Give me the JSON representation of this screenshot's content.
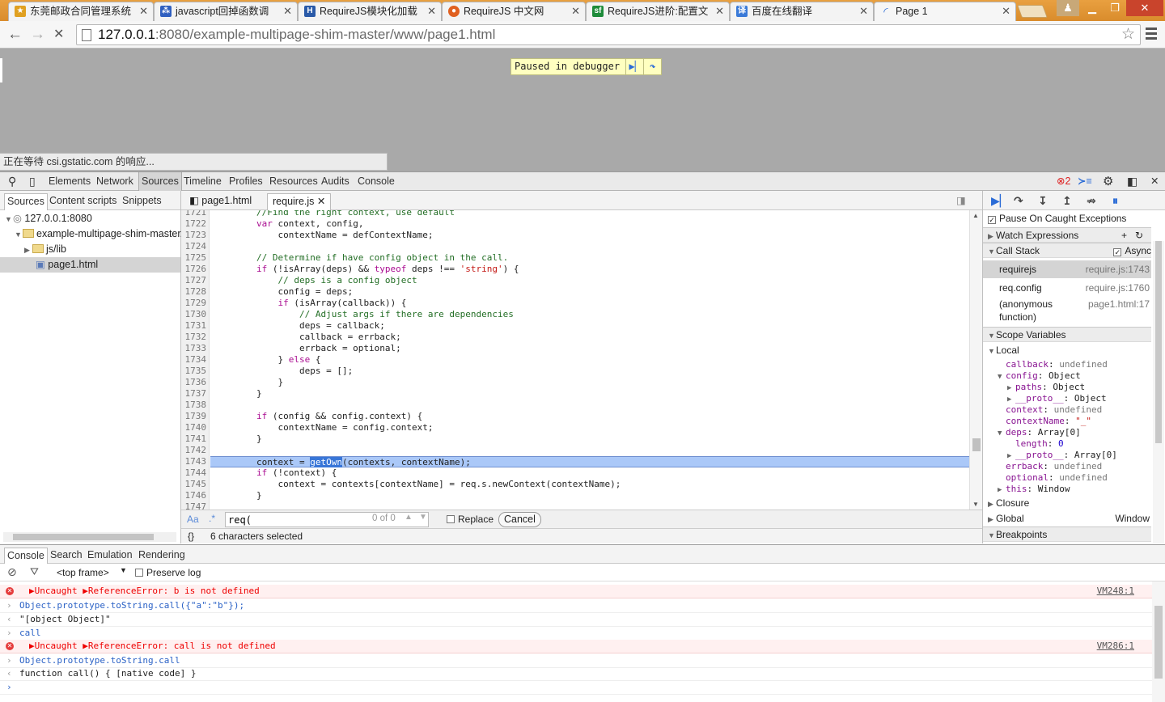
{
  "browser": {
    "tabs": [
      {
        "title": "东莞邮政合同管理系统",
        "favicon_color": "#e0a020"
      },
      {
        "title": "javascript回掉函数调",
        "favicon_color": "#3060c0"
      },
      {
        "title": "RequireJS模块化加载",
        "favicon_color": "#2a5aa8"
      },
      {
        "title": "RequireJS 中文网",
        "favicon_color": "#e06020"
      },
      {
        "title": "RequireJS进阶:配置文",
        "favicon_color": "#1e8c3a"
      },
      {
        "title": "百度在线翻译",
        "favicon_color": "#3a7ad8"
      },
      {
        "title": "Page 1",
        "favicon_color": "#2a6bd6"
      }
    ],
    "url_host": "127.0.0.1",
    "url_path": ":8080/example-multipage-shim-master/www/page1.html"
  },
  "viewport": {
    "paused_text": "Paused in debugger",
    "status_text": "正在等待 csi.gstatic.com 的响应..."
  },
  "devtools": {
    "main_tabs": [
      "Elements",
      "Network",
      "Sources",
      "Timeline",
      "Profiles",
      "Resources",
      "Audits",
      "Console"
    ],
    "error_count": "2",
    "nav_tabs": [
      "Sources",
      "Content scripts",
      "Snippets"
    ],
    "tree": {
      "host": "127.0.0.1:8080",
      "folder": "example-multipage-shim-master/",
      "subfolder": "js/lib",
      "file": "page1.html"
    },
    "editor_tabs": [
      "page1.html",
      "require.js"
    ],
    "code_lines": [
      {
        "n": "1721",
        "t": "        //Find the right context, use default"
      },
      {
        "n": "1722",
        "t": "        var context, config,"
      },
      {
        "n": "1723",
        "t": "            contextName = defContextName;"
      },
      {
        "n": "1724",
        "t": ""
      },
      {
        "n": "1725",
        "t": "        // Determine if have config object in the call."
      },
      {
        "n": "1726",
        "t": "        if (!isArray(deps) && typeof deps !== 'string') {"
      },
      {
        "n": "1727",
        "t": "            // deps is a config object"
      },
      {
        "n": "1728",
        "t": "            config = deps;"
      },
      {
        "n": "1729",
        "t": "            if (isArray(callback)) {"
      },
      {
        "n": "1730",
        "t": "                // Adjust args if there are dependencies"
      },
      {
        "n": "1731",
        "t": "                deps = callback;"
      },
      {
        "n": "1732",
        "t": "                callback = errback;"
      },
      {
        "n": "1733",
        "t": "                errback = optional;"
      },
      {
        "n": "1734",
        "t": "            } else {"
      },
      {
        "n": "1735",
        "t": "                deps = [];"
      },
      {
        "n": "1736",
        "t": "            }"
      },
      {
        "n": "1737",
        "t": "        }"
      },
      {
        "n": "1738",
        "t": ""
      },
      {
        "n": "1739",
        "t": "        if (config && config.context) {"
      },
      {
        "n": "1740",
        "t": "            contextName = config.context;"
      },
      {
        "n": "1741",
        "t": "        }"
      },
      {
        "n": "1742",
        "t": ""
      },
      {
        "n": "1743",
        "t": "        context = getOwn(contexts, contextName);"
      },
      {
        "n": "1744",
        "t": "        if (!context) {"
      },
      {
        "n": "1745",
        "t": "            context = contexts[contextName] = req.s.newContext(contextName);"
      },
      {
        "n": "1746",
        "t": "        }"
      },
      {
        "n": "1747",
        "t": ""
      }
    ],
    "search": {
      "aa": "Aa",
      "regex": ".*",
      "query": "req(",
      "count": "0 of 0",
      "replace_label": "Replace",
      "cancel_label": "Cancel"
    },
    "status": {
      "braces": "{}",
      "text": "6 characters selected"
    },
    "sidebar": {
      "pause_caught": "Pause On Caught Exceptions",
      "watch": "Watch Expressions",
      "call_stack": "Call Stack",
      "async": "Async",
      "frames": [
        {
          "fn": "requirejs",
          "loc": "require.js:1743"
        },
        {
          "fn": "req.config",
          "loc": "require.js:1760"
        },
        {
          "fn": "(anonymous",
          "fn2": "function)",
          "loc": "page1.html:17"
        }
      ],
      "scope_vars": "Scope Variables",
      "local": "Local",
      "vars": [
        {
          "k": "callback",
          "v": "undefined"
        },
        {
          "k": "config",
          "v": "Object"
        },
        {
          "k": "paths",
          "v": "Object"
        },
        {
          "k": "__proto__",
          "v": "Object"
        },
        {
          "k": "context",
          "v": "undefined"
        },
        {
          "k": "contextName",
          "v": "\"_\""
        },
        {
          "k": "deps",
          "v": "Array[0]"
        },
        {
          "k": "length",
          "v": "0"
        },
        {
          "k": "__proto__",
          "v": "Array[0]"
        },
        {
          "k": "errback",
          "v": "undefined"
        },
        {
          "k": "optional",
          "v": "undefined"
        },
        {
          "k": "this",
          "v": "Window"
        }
      ],
      "closure": "Closure",
      "global": "Global",
      "global_val": "Window",
      "breakpoints": "Breakpoints"
    },
    "drawer_tabs": [
      "Console",
      "Search",
      "Emulation",
      "Rendering"
    ],
    "console_bar": {
      "frame": "<top frame>",
      "preserve": "Preserve log"
    },
    "console_rows": [
      {
        "type": "err",
        "text": "▶Uncaught ▶ReferenceError: b is not defined",
        "src": "VM248:1"
      },
      {
        "type": "in",
        "text": "Object.prototype.toString.call({\"a\":\"b\"});"
      },
      {
        "type": "out",
        "text": "\"[object Object]\""
      },
      {
        "type": "in",
        "text": "call"
      },
      {
        "type": "err",
        "text": "▶Uncaught ▶ReferenceError: call is not defined",
        "src": "VM286:1"
      },
      {
        "type": "in",
        "text": "Object.prototype.toString.call"
      },
      {
        "type": "out",
        "text": "function call() { [native code] }"
      },
      {
        "type": "prompt",
        "text": ""
      }
    ]
  }
}
